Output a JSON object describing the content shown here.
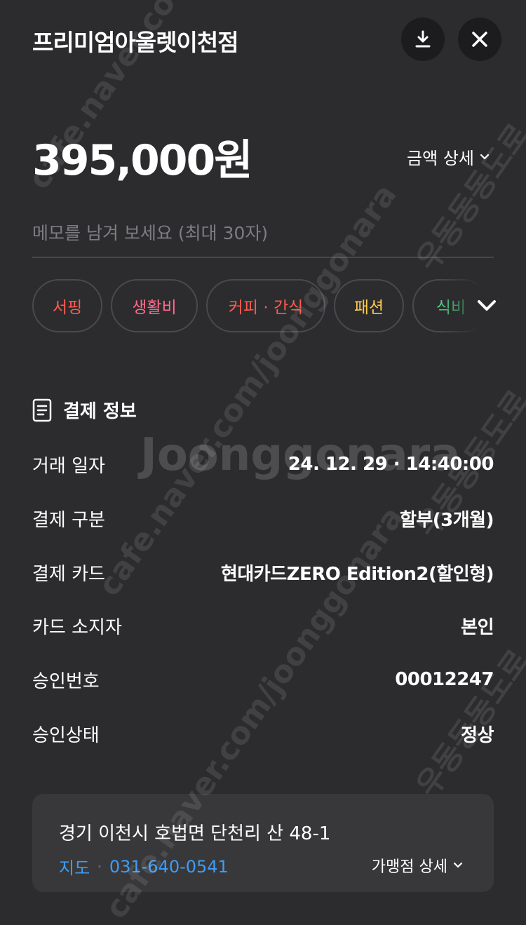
{
  "header": {
    "title": "프리미엄아울렛이천점"
  },
  "icons": {
    "download": "download-icon",
    "close": "close-icon"
  },
  "amount": {
    "value": "395,000원",
    "detail_label": "금액 상세"
  },
  "memo": {
    "placeholder": "메모를 남겨 보세요 (최대 30자)",
    "value": ""
  },
  "categories": [
    {
      "label": "서핑",
      "color": "#ff5a4f"
    },
    {
      "label": "생활비",
      "color": "#ff6b8a"
    },
    {
      "label": "커피 · 간식",
      "color": "#ff5a4f"
    },
    {
      "label": "패션",
      "color": "#ffc94d"
    },
    {
      "label": "식비",
      "color": "#54d68a"
    }
  ],
  "payment_info": {
    "title": "결제 정보",
    "rows": [
      {
        "label": "거래 일자",
        "value": "24. 12. 29 · 14:40:00"
      },
      {
        "label": "결제 구분",
        "value": "할부(3개월)"
      },
      {
        "label": "결제 카드",
        "value": "현대카드ZERO Edition2(할인형)"
      },
      {
        "label": "카드 소지자",
        "value": "본인"
      },
      {
        "label": "승인번호",
        "value": "00012247"
      },
      {
        "label": "승인상태",
        "value": "정상"
      }
    ]
  },
  "merchant": {
    "address": "경기 이천시 호법면 단천리 산 48-1",
    "map_label": "지도",
    "phone": "031-640-0541",
    "detail_label": "가맹점 상세"
  },
  "colors": {
    "background": "#2c2c2e",
    "link": "#3d9df6",
    "card": "#38383a"
  },
  "watermark": {
    "url_text": "cafe.naver.com/joonggonara",
    "brand_text": "Joonggonara",
    "side_text": "우동동동도로"
  }
}
